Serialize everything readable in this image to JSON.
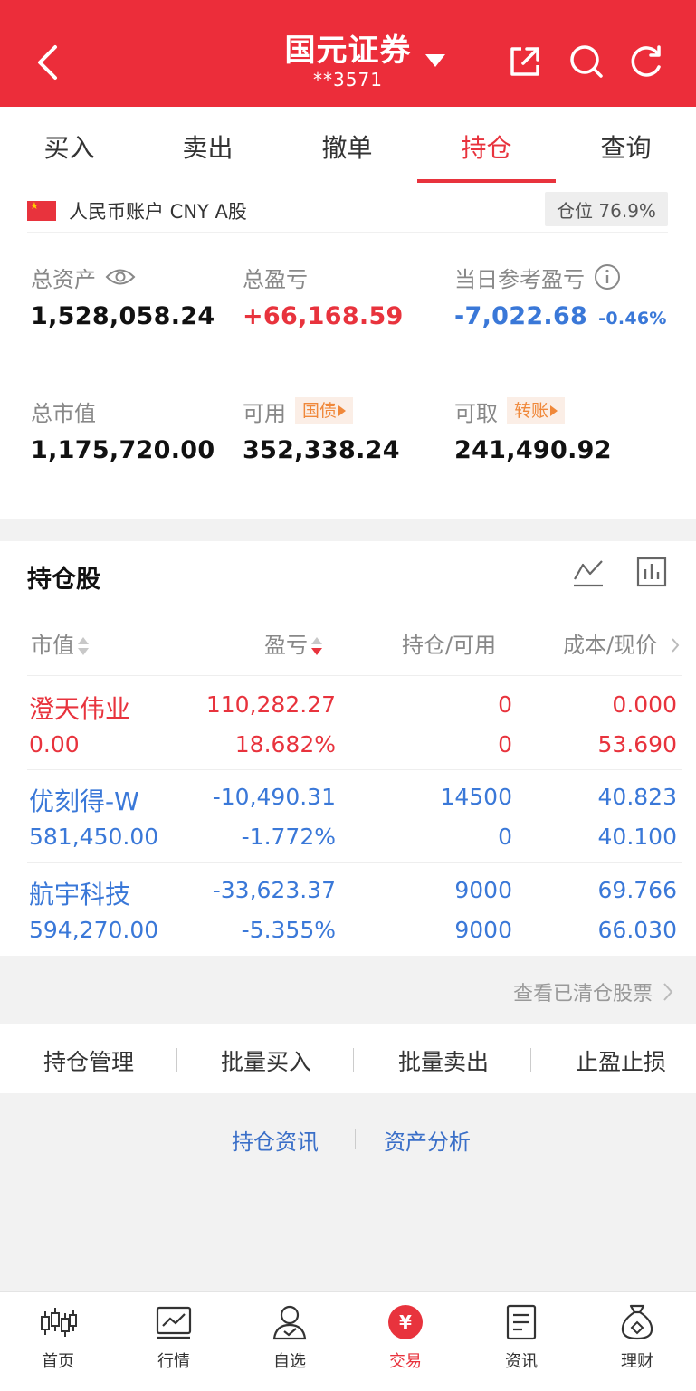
{
  "header": {
    "title": "国元证券",
    "account_masked": "**3571"
  },
  "tabs": [
    {
      "label": "买入",
      "active": false
    },
    {
      "label": "卖出",
      "active": false
    },
    {
      "label": "撤单",
      "active": false
    },
    {
      "label": "持仓",
      "active": true
    },
    {
      "label": "查询",
      "active": false
    }
  ],
  "account": {
    "label": "人民币账户 CNY A股",
    "position_ratio": "仓位 76.9%"
  },
  "summary": {
    "total_assets": {
      "label": "总资产",
      "value": "1,528,058.24"
    },
    "total_pnl": {
      "label": "总盈亏",
      "value": "+66,168.59"
    },
    "today_pnl": {
      "label": "当日参考盈亏",
      "value": "-7,022.68",
      "pct": "-0.46%"
    },
    "market_value": {
      "label": "总市值",
      "value": "1,175,720.00"
    },
    "available": {
      "label": "可用",
      "tag": "国债",
      "value": "352,338.24"
    },
    "withdrawable": {
      "label": "可取",
      "tag": "转账",
      "value": "241,490.92"
    }
  },
  "holdings": {
    "title": "持仓股",
    "columns": [
      "市值",
      "盈亏",
      "持仓/可用",
      "成本/现价"
    ],
    "rows": [
      {
        "name": "澄天伟业",
        "market_value": "0.00",
        "pnl": "110,282.27",
        "pnl_pct": "18.682%",
        "position": "0",
        "available": "0",
        "cost": "0.000",
        "price": "53.690",
        "tone": "red"
      },
      {
        "name": "优刻得-W",
        "market_value": "581,450.00",
        "pnl": "-10,490.31",
        "pnl_pct": "-1.772%",
        "position": "14500",
        "available": "0",
        "cost": "40.823",
        "price": "40.100",
        "tone": "blue"
      },
      {
        "name": "航宇科技",
        "market_value": "594,270.00",
        "pnl": "-33,623.37",
        "pnl_pct": "-5.355%",
        "position": "9000",
        "available": "9000",
        "cost": "69.766",
        "price": "66.030",
        "tone": "blue"
      }
    ],
    "view_cleared": "查看已清仓股票"
  },
  "actions": [
    "持仓管理",
    "批量买入",
    "批量卖出",
    "止盈止损"
  ],
  "links": [
    "持仓资讯",
    "资产分析"
  ],
  "tabbar": [
    {
      "label": "首页",
      "icon": "candlestick-icon",
      "active": false
    },
    {
      "label": "行情",
      "icon": "chart-icon",
      "active": false
    },
    {
      "label": "自选",
      "icon": "user-icon",
      "active": false
    },
    {
      "label": "交易",
      "icon": "yuan-icon",
      "glyph": "¥",
      "active": true
    },
    {
      "label": "资讯",
      "icon": "document-icon",
      "active": false
    },
    {
      "label": "理财",
      "icon": "money-bag-icon",
      "active": false
    }
  ],
  "colors": {
    "brand": "#ec2d3a",
    "up": "#e8333d",
    "down": "#3a78d8",
    "tag": "#f0883a"
  }
}
